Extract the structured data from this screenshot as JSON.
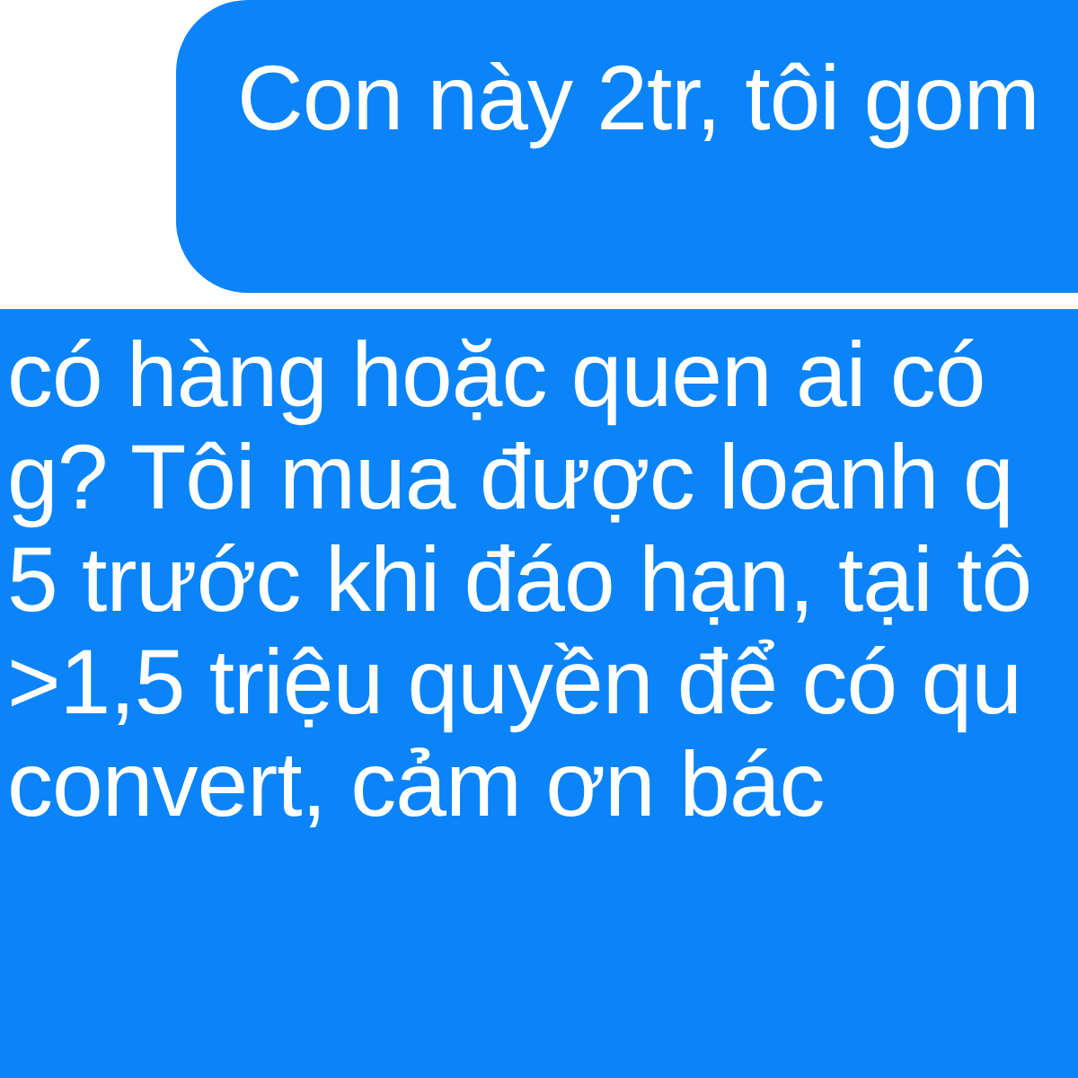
{
  "messages": [
    {
      "lines": [
        "Con này 2tr, tôi gom"
      ]
    },
    {
      "lines": [
        "có hàng hoặc quen ai có",
        "g? Tôi mua được loanh q",
        "5 trước khi đáo hạn, tại tô",
        ">1,5 triệu quyền để có qu",
        "convert, cảm ơn bác"
      ]
    }
  ]
}
